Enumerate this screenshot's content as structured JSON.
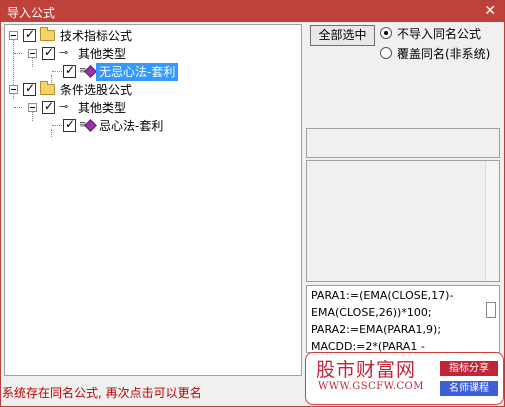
{
  "window": {
    "title": "导入公式",
    "close_glyph": "✕"
  },
  "tree": {
    "nodes": [
      {
        "label": "技术指标公式",
        "checked": true,
        "icon": "folder-icon"
      },
      {
        "label": "其他类型",
        "checked": true,
        "icon": "key-icon"
      },
      {
        "label": "无忌心法-套利",
        "checked": true,
        "icon": "gem-icon",
        "selected": true
      },
      {
        "label": "条件选股公式",
        "checked": true,
        "icon": "folder-icon"
      },
      {
        "label": "其他类型",
        "checked": true,
        "icon": "key-icon"
      },
      {
        "label": "忌心法-套利",
        "checked": true,
        "icon": "gem-icon"
      }
    ]
  },
  "options": {
    "select_all_label": "全部选中",
    "radio_no_import": "不导入同名公式",
    "radio_overwrite": "覆盖同名(非系统)",
    "selected": "no_import"
  },
  "code_preview": {
    "lines": [
      "PARA1:=(EMA(CLOSE,17)-",
      "EMA(CLOSE,26))*100;",
      "PARA2:=EMA(PARA1,9);",
      "MACDD:=2*(PARA1 -"
    ]
  },
  "status": {
    "message": "系统存在同名公式, 再次点击可以更名"
  },
  "watermark": {
    "brand": "股市财富网",
    "url": "WWW.GSCFW.COM",
    "tag1": "指标分享",
    "tag2": "名师课程"
  }
}
